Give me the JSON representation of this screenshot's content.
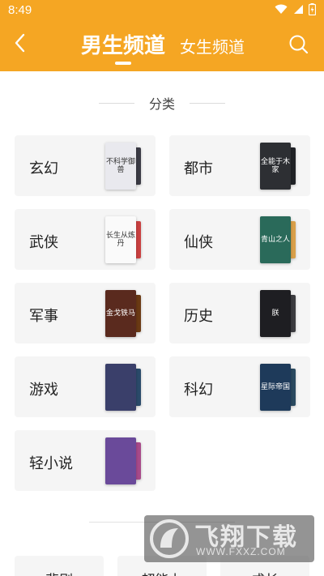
{
  "status_bar": {
    "time": "8:49"
  },
  "header": {
    "tabs": [
      {
        "label": "男生频道",
        "active": true
      },
      {
        "label": "女生频道",
        "active": false
      }
    ],
    "accent": "#f5a623"
  },
  "section": {
    "title": "分类"
  },
  "categories": [
    {
      "label": "玄幻",
      "cover_text": "不科学御兽",
      "cover_color": "#e9e9ee",
      "back_color": "#3a3a44"
    },
    {
      "label": "都市",
      "cover_text": "全能于木家",
      "cover_color": "#2d2f33",
      "back_color": "#202226"
    },
    {
      "label": "武侠",
      "cover_text": "长生从炼丹",
      "cover_color": "#fafafa",
      "back_color": "#c94040"
    },
    {
      "label": "仙侠",
      "cover_text": "青山之人",
      "cover_color": "#2a6a5a",
      "back_color": "#d9a04a"
    },
    {
      "label": "军事",
      "cover_text": "金戈铁马",
      "cover_color": "#5a2a1e",
      "back_color": "#6b3a14"
    },
    {
      "label": "历史",
      "cover_text": "朕",
      "cover_color": "#1e1e22",
      "back_color": "#3c3c40"
    },
    {
      "label": "游戏",
      "cover_text": "",
      "cover_color": "#3a3f6a",
      "back_color": "#2a4a6a"
    },
    {
      "label": "科幻",
      "cover_text": "星际帝国",
      "cover_color": "#1e3a5a",
      "back_color": "#2a4a60"
    },
    {
      "label": "轻小说",
      "cover_text": "",
      "cover_color": "#6a4a9a",
      "back_color": "#a84a8a"
    }
  ],
  "next_section": {
    "items": [
      "悲剧",
      "超能力",
      "成长"
    ]
  },
  "watermark": {
    "title": "飞翔下载",
    "url": "WWW.FXXZ.COM"
  }
}
